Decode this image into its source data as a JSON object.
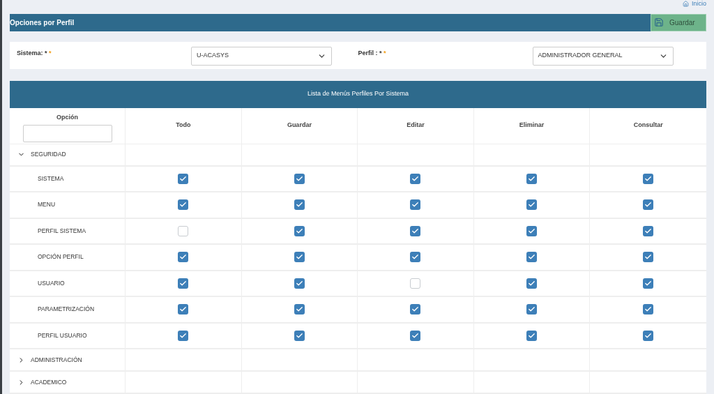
{
  "top_link": {
    "label": "Inicio"
  },
  "header": {
    "title": "Opciones por Perfil",
    "save_button": "Guardar"
  },
  "form": {
    "fields": [
      {
        "label": "Sistema: *",
        "required_mark": "*",
        "value": "U-ACASYS"
      },
      {
        "label": "Perfil : *",
        "required_mark": "*",
        "value": "ADMINISTRADOR GENERAL"
      }
    ]
  },
  "table": {
    "title": "Lista de Menús Perfiles Por Sistema",
    "option_column": "Opción",
    "columns": [
      "Todo",
      "Guardar",
      "Editar",
      "Eliminar",
      "Consultar"
    ],
    "groups": [
      {
        "label": "SEGURIDAD",
        "expanded": true,
        "children": [
          {
            "label": "SISTEMA",
            "checks": [
              {
                "checked": true
              },
              {
                "checked": true
              },
              {
                "checked": true
              },
              {
                "checked": true
              },
              {
                "checked": true
              }
            ]
          },
          {
            "label": "MENU",
            "checks": [
              {
                "checked": true
              },
              {
                "checked": true
              },
              {
                "checked": true
              },
              {
                "checked": true
              },
              {
                "checked": true
              }
            ]
          },
          {
            "label": "PERFIL SISTEMA",
            "checks": [
              {
                "checked": false
              },
              {
                "checked": true
              },
              {
                "checked": true
              },
              {
                "checked": true
              },
              {
                "checked": true
              }
            ]
          },
          {
            "label": "OPCIÓN PERFIL",
            "checks": [
              {
                "checked": true
              },
              {
                "checked": true
              },
              {
                "checked": true
              },
              {
                "checked": true
              },
              {
                "checked": true
              }
            ]
          },
          {
            "label": "USUARIO",
            "checks": [
              {
                "checked": true
              },
              {
                "checked": true
              },
              {
                "checked": false
              },
              {
                "checked": true
              },
              {
                "checked": true
              }
            ]
          },
          {
            "label": "PARAMETRIZACIÓN",
            "checks": [
              {
                "checked": true
              },
              {
                "checked": true
              },
              {
                "checked": true
              },
              {
                "checked": true
              },
              {
                "checked": true
              }
            ]
          },
          {
            "label": "PERFIL USUARIO",
            "checks": [
              {
                "checked": true
              },
              {
                "checked": true
              },
              {
                "checked": true
              },
              {
                "checked": true
              },
              {
                "checked": true
              }
            ]
          }
        ]
      },
      {
        "label": "ADMINISTRACIÓN",
        "expanded": false
      },
      {
        "label": "ACADEMICO",
        "expanded": false
      }
    ]
  }
}
